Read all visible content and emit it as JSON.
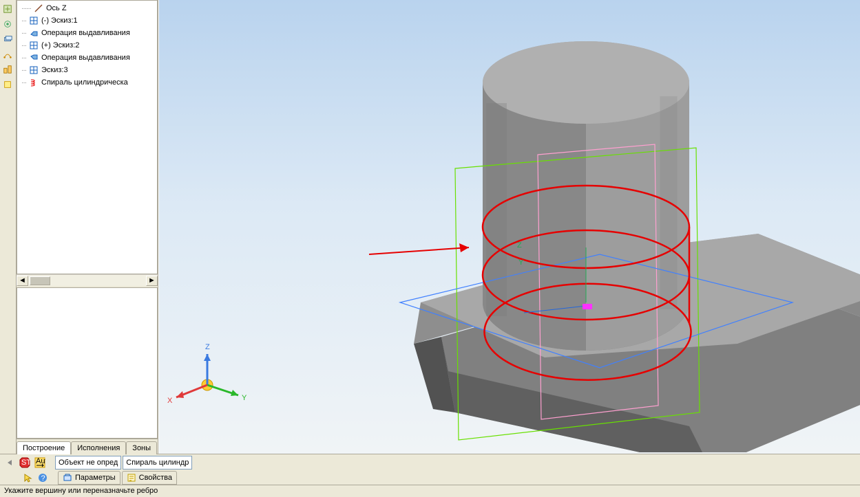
{
  "tree": {
    "items": [
      {
        "label": "Ось Z",
        "icon": "axis"
      },
      {
        "label": "(-) Эскиз:1",
        "icon": "sketch"
      },
      {
        "label": "Операция выдавливания",
        "icon": "extrude"
      },
      {
        "label": "(+) Эскиз:2",
        "icon": "sketch"
      },
      {
        "label": "Операция выдавливания",
        "icon": "extrude2"
      },
      {
        "label": "Эскиз:3",
        "icon": "sketch"
      },
      {
        "label": "Спираль цилиндрическа",
        "icon": "spiral"
      }
    ]
  },
  "tabs": {
    "items": [
      "Построение",
      "Исполнения",
      "Зоны"
    ],
    "active": 0
  },
  "bottom_bar": {
    "object_field": "Объект не опред",
    "spiral_field": "Спираль цилиндр",
    "prop_tabs": [
      "Параметры",
      "Свойства"
    ]
  },
  "status_bar": "Укажите вершину или переназначьте ребро",
  "viewport": {
    "axis_labels": {
      "x": "X",
      "y": "Y",
      "z": "Z"
    },
    "origin_labels": {
      "z": "Z",
      "y": "Y"
    }
  },
  "colors": {
    "spiral": "#e60000",
    "arrow": "#e60000",
    "green": "#68e000",
    "blue": "#4080ff",
    "pink": "#ffa0d0",
    "steel1": "#9d9d9d",
    "steel2": "#787878",
    "steel3": "#606060"
  }
}
